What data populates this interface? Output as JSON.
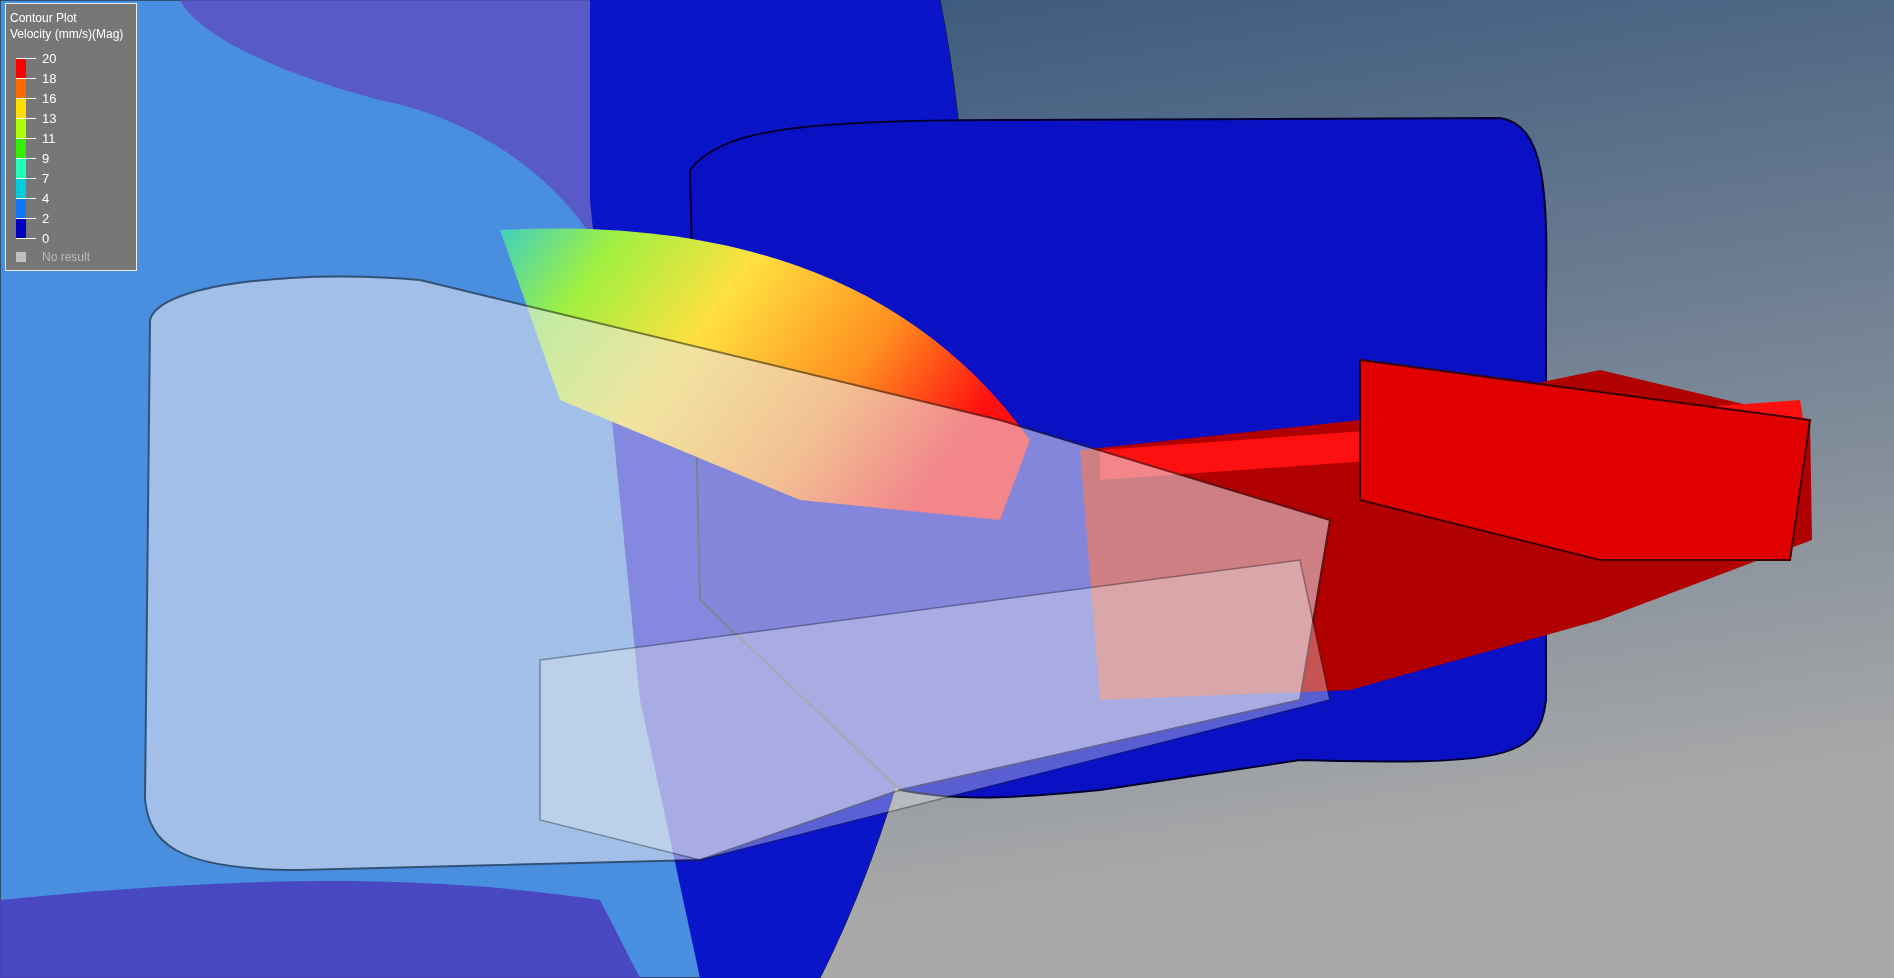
{
  "legend": {
    "title": "Contour Plot",
    "subtitle": "Velocity (mm/s)(Mag)",
    "ticks": [
      "20",
      "18",
      "16",
      "13",
      "11",
      "9",
      "7",
      "4",
      "2",
      "0"
    ],
    "bands": [
      {
        "color": "#ff0000"
      },
      {
        "color": "#ff6a00"
      },
      {
        "color": "#ffdd00"
      },
      {
        "color": "#aaff00"
      },
      {
        "color": "#33ee00"
      },
      {
        "color": "#22ffbb"
      },
      {
        "color": "#00ccdd"
      },
      {
        "color": "#1177ff"
      },
      {
        "color": "#0000c0"
      }
    ],
    "no_result": {
      "label": "No result",
      "color": "#c0c0c0"
    }
  }
}
